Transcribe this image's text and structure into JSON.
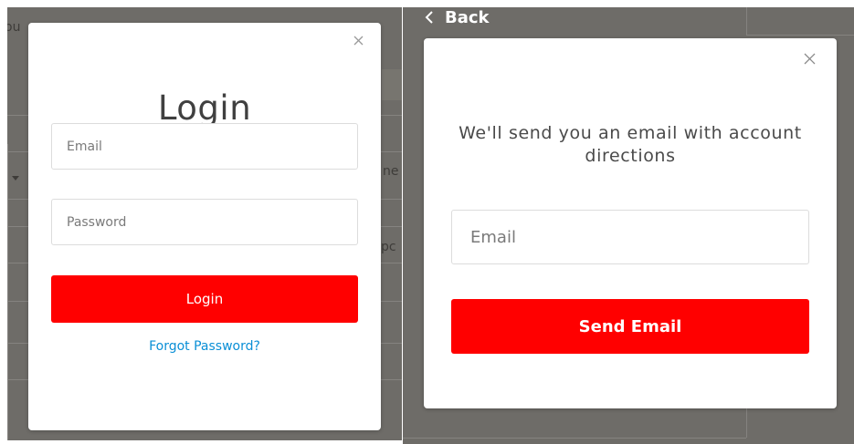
{
  "login": {
    "title": "Login",
    "email_placeholder": "Email",
    "password_placeholder": "Password",
    "submit_label": "Login",
    "forgot_label": "Forgot Password?"
  },
  "forgot": {
    "back_label": "Back",
    "description": "We'll send you an email with account directions",
    "email_placeholder": "Email",
    "submit_label": "Send Email"
  },
  "background": {
    "fragment_top": "ou",
    "fragment_mid": "ne",
    "fragment_low": "pc"
  },
  "colors": {
    "accent": "#ff0000",
    "link": "#0a8fd6",
    "overlay": "#6e6c68"
  },
  "icons": {
    "close": "close-icon",
    "back": "chevron-left-icon",
    "dropdown": "caret-down-icon"
  }
}
